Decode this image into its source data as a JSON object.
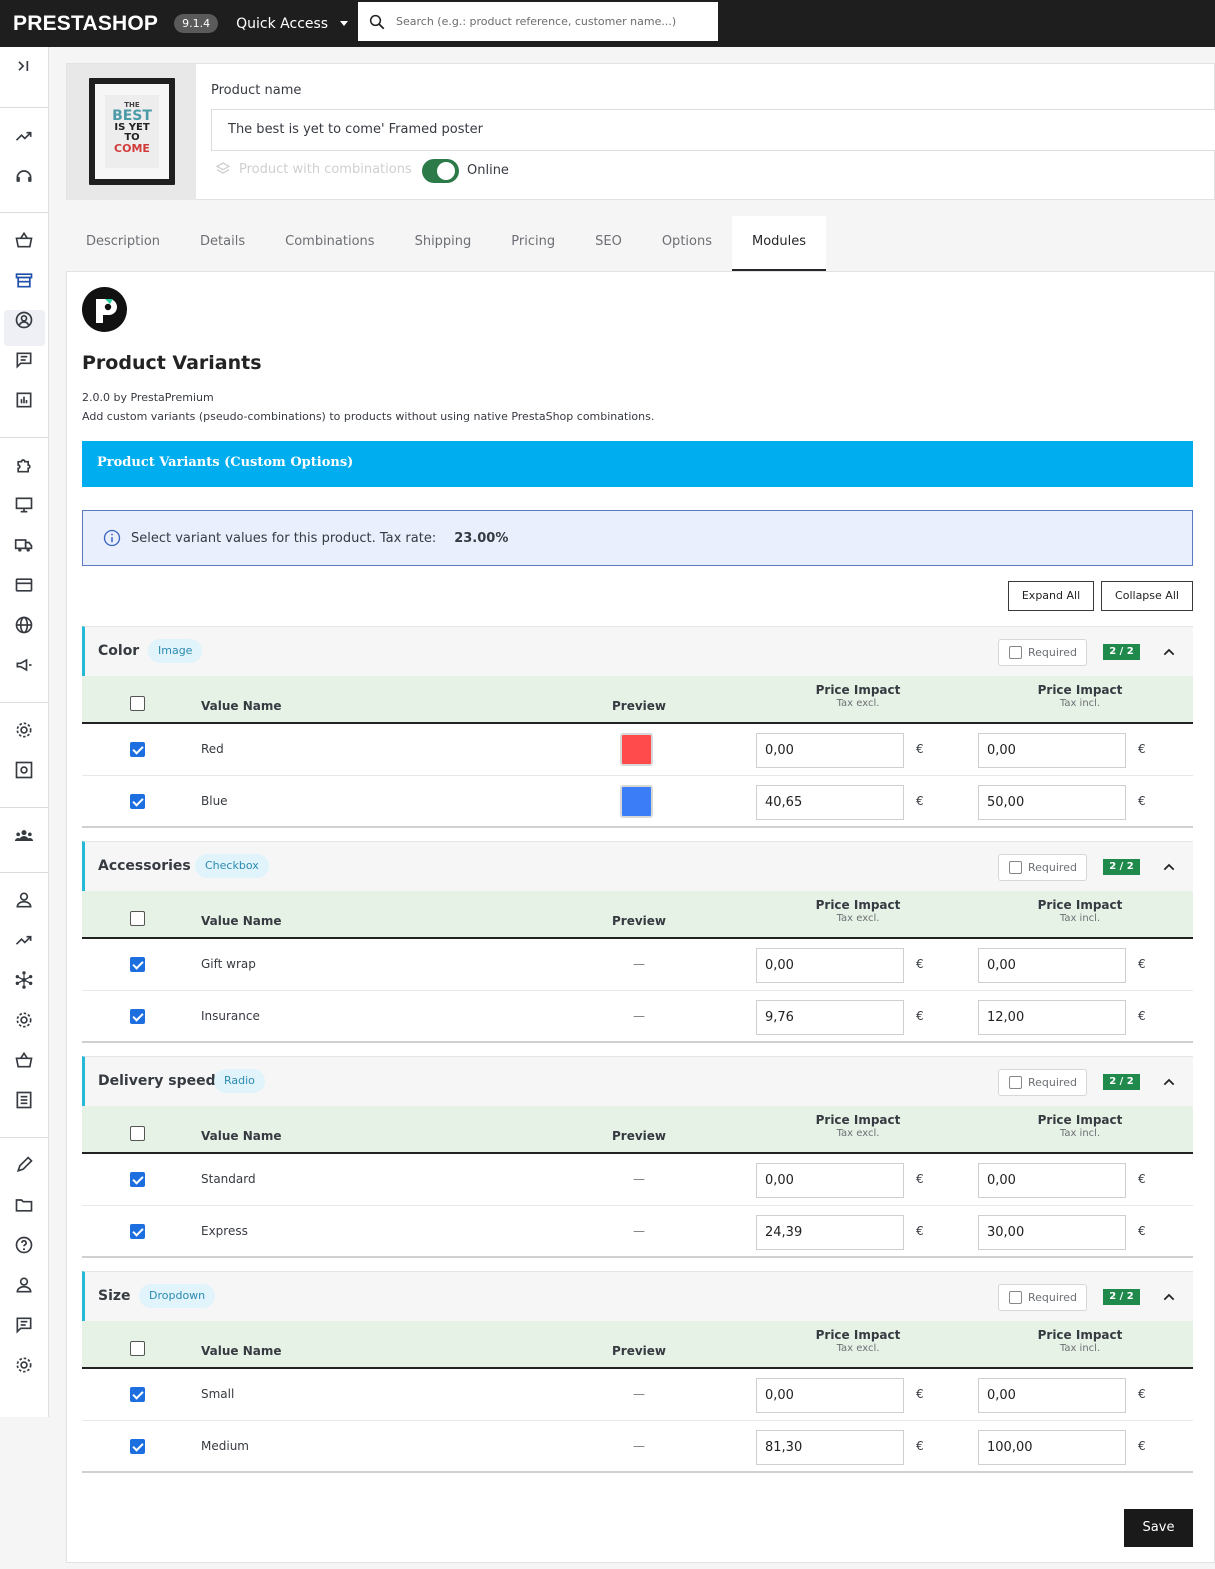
{
  "app": {
    "brand": "PRESTASHOP",
    "version": "9.1.4",
    "quick_access": "Quick Access",
    "search_placeholder": "Search (e.g.: product reference, customer name...)"
  },
  "product": {
    "name_label": "Product name",
    "name_value": "The best is yet to come' Framed poster",
    "combinations_label": "Product with combinations",
    "online_label": "Online",
    "online": true
  },
  "tabs": [
    "Description",
    "Details",
    "Combinations",
    "Shipping",
    "Pricing",
    "SEO",
    "Options",
    "Modules"
  ],
  "active_tab": "Modules",
  "module": {
    "title": "Product Variants",
    "version": "2.0.0 by PrestaPremium",
    "description": "Add custom variants (pseudo-combinations) to products without using native PrestaShop combinations.",
    "bar_title": "Product Variants (Custom Options)",
    "info_text": "Select variant values for this product. Tax rate:",
    "tax_rate": "23.00%",
    "expand_all": "Expand All",
    "collapse_all": "Collapse All",
    "save": "Save"
  },
  "table_headers": {
    "select": "",
    "value_name": "Value Name",
    "preview": "Preview",
    "price_impact": "Price Impact",
    "tax_excl": "Tax excl.",
    "tax_incl": "Tax incl.",
    "currency": "€",
    "required": "Required"
  },
  "groups": [
    {
      "name": "Color",
      "type": "Image",
      "required": false,
      "count": "2 / 2",
      "rows": [
        {
          "name": "Red",
          "checked": true,
          "preview": "",
          "swatch": "#ff4b4b",
          "excl": "0,00",
          "incl": "0,00"
        },
        {
          "name": "Blue",
          "checked": true,
          "preview": "",
          "swatch": "#3b7cf7",
          "excl": "40,65",
          "incl": "50,00"
        }
      ]
    },
    {
      "name": "Accessories",
      "type": "Checkbox",
      "required": false,
      "count": "2 / 2",
      "rows": [
        {
          "name": "Gift wrap",
          "checked": true,
          "preview": "—",
          "excl": "0,00",
          "incl": "0,00"
        },
        {
          "name": "Insurance",
          "checked": true,
          "preview": "—",
          "excl": "9,76",
          "incl": "12,00"
        }
      ]
    },
    {
      "name": "Delivery speed",
      "type": "Radio",
      "required": false,
      "count": "2 / 2",
      "rows": [
        {
          "name": "Standard",
          "checked": true,
          "preview": "—",
          "excl": "0,00",
          "incl": "0,00"
        },
        {
          "name": "Express",
          "checked": true,
          "preview": "—",
          "excl": "24,39",
          "incl": "30,00"
        }
      ]
    },
    {
      "name": "Size",
      "type": "Dropdown",
      "required": false,
      "count": "2 / 2",
      "rows": [
        {
          "name": "Small",
          "checked": true,
          "preview": "—",
          "excl": "0,00",
          "incl": "0,00"
        },
        {
          "name": "Medium",
          "checked": true,
          "preview": "—",
          "excl": "81,30",
          "incl": "100,00"
        }
      ]
    }
  ],
  "poster": {
    "line1": "THE",
    "line2": "BEST",
    "line3": "IS YET TO",
    "line4": "COME"
  },
  "colors": {
    "accent": "#25b9d7",
    "info_bar": "#00aeef",
    "toggle": "#2c7a48",
    "count_badge": "#1f8a4c",
    "checkbox": "#1d6fe0"
  },
  "sidebar_icons": [
    "collapse-icon",
    "dashboard-trend-icon",
    "support-icon",
    "orders-basket-icon",
    "catalog-store-icon",
    "customers-icon",
    "messages-icon",
    "stats-icon",
    "modules-puzzle-icon",
    "design-monitor-icon",
    "shipping-truck-icon",
    "payment-card-icon",
    "international-globe-icon",
    "marketing-megaphone-icon",
    "configure-gear-icon",
    "advanced-params-icon",
    "team-icon",
    "user-icon",
    "trending-icon",
    "network-icon",
    "settings-icon",
    "basket-icon",
    "list-icon",
    "pencil-icon",
    "folder-icon",
    "help-icon",
    "account-icon",
    "comments-icon",
    "cog-icon"
  ]
}
